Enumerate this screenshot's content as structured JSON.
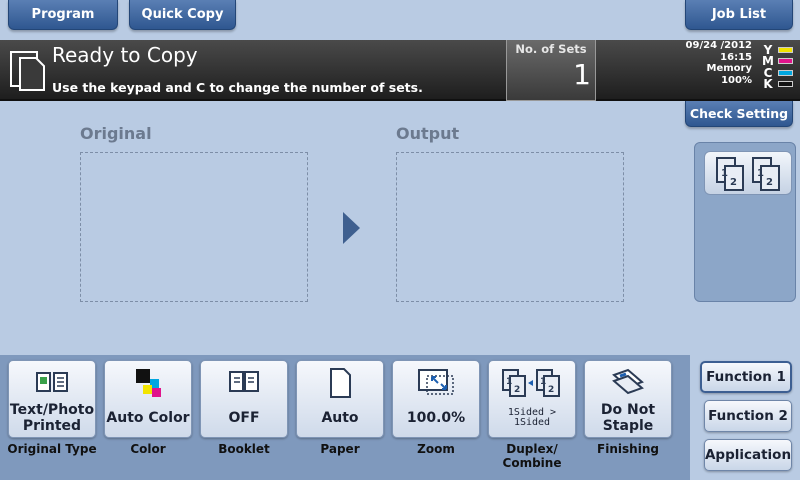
{
  "top_tabs": {
    "program": "Program",
    "quick_copy": "Quick Copy",
    "job_list": "Job List"
  },
  "status": {
    "title": "Ready to Copy",
    "message": "Use the keypad and C to change the number of sets.",
    "sets_label": "No. of Sets",
    "sets_value": "1",
    "date": "09/24 /2012",
    "time": "16:15",
    "memory_label": "Memory",
    "memory_value": "100%",
    "toner": [
      {
        "letter": "Y",
        "color": "#f2e400"
      },
      {
        "letter": "M",
        "color": "#e0148c"
      },
      {
        "letter": "C",
        "color": "#00a6e0"
      },
      {
        "letter": "K",
        "color": "#111111"
      }
    ]
  },
  "check_setting": "Check Setting",
  "main": {
    "original_label": "Original",
    "output_label": "Output"
  },
  "tiles": [
    {
      "value": "Text/Photo Printed",
      "caption": "Original Type",
      "icon": "book-icon"
    },
    {
      "value": "Auto Color",
      "caption": "Color",
      "icon": "color-squares-icon"
    },
    {
      "value": "OFF",
      "caption": "Booklet",
      "icon": "booklet-icon"
    },
    {
      "value": "Auto",
      "caption": "Paper",
      "icon": "paper-icon"
    },
    {
      "value": "100.0%",
      "caption": "Zoom",
      "icon": "zoom-icon"
    },
    {
      "value": "1Sided > 1Sided",
      "caption": "Duplex/ Combine",
      "icon": "duplex-icon"
    },
    {
      "value": "Do Not Staple",
      "caption": "Finishing",
      "icon": "staple-icon"
    }
  ],
  "functions": {
    "function1": "Function 1",
    "function2": "Function 2",
    "application": "Application"
  }
}
